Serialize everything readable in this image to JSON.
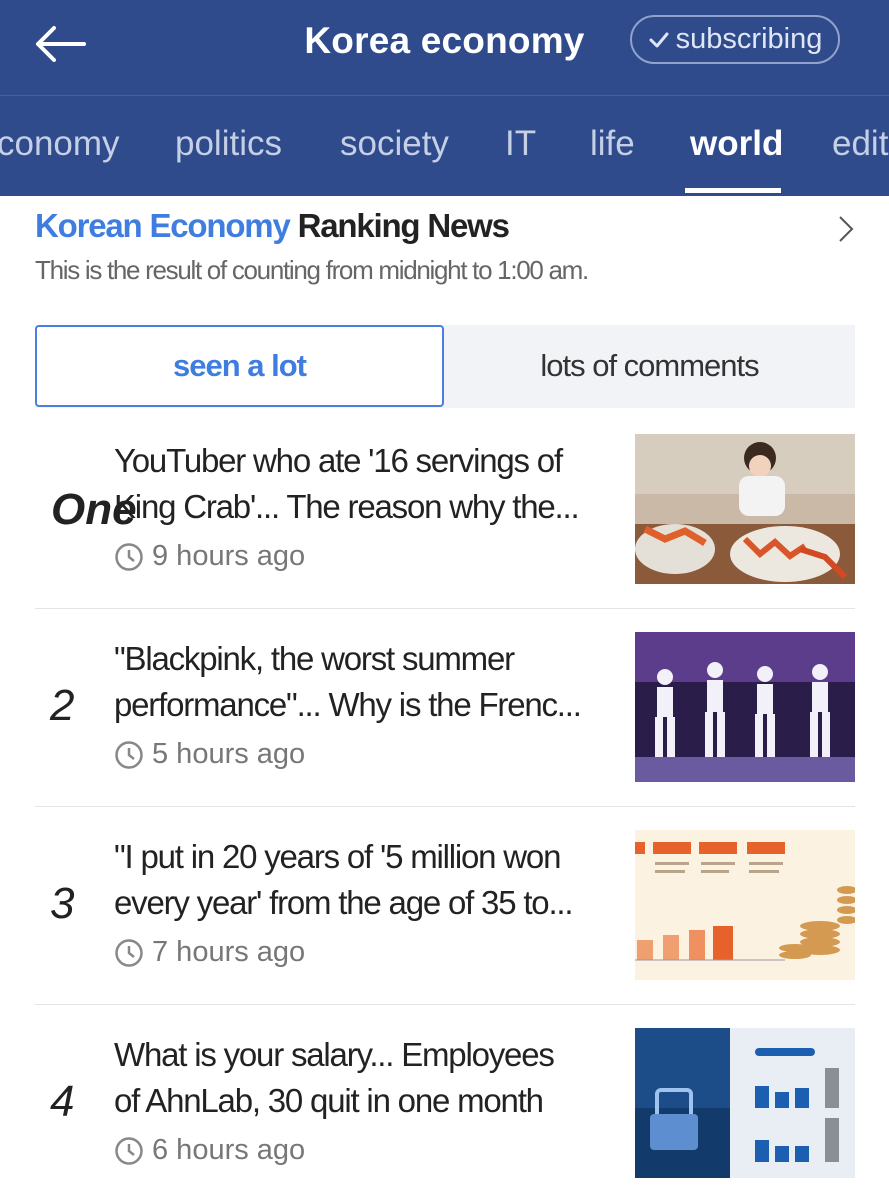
{
  "header": {
    "title": "Korea economy",
    "subscribe_label": "subscribing"
  },
  "tabs": [
    {
      "label": "conomy"
    },
    {
      "label": "politics"
    },
    {
      "label": "society"
    },
    {
      "label": "IT"
    },
    {
      "label": "life"
    },
    {
      "label": "world",
      "active": true
    },
    {
      "label": "edit"
    }
  ],
  "ranking": {
    "brand": "Korean Economy",
    "title": "Ranking News",
    "subtitle": "This is the result of counting from midnight to 1:00 am."
  },
  "segments": {
    "active": "seen a lot",
    "inactive": "lots of comments"
  },
  "articles": [
    {
      "rank": "One",
      "line1": "YouTuber who ate '16 servings of",
      "line2": "King Crab'... The reason why the...",
      "time": "9 hours ago",
      "thumb_icon": "king-crab-photo"
    },
    {
      "rank": "2",
      "line1": "\"Blackpink, the worst summer",
      "line2": "performance\"... Why is the Frenc...",
      "time": "5 hours ago",
      "thumb_icon": "concert-photo"
    },
    {
      "rank": "3",
      "line1": "\"I put in 20 years of '5 million won",
      "line2": "every year' from the age of 35 to...",
      "time": "7 hours ago",
      "thumb_icon": "pension-chart-graphic"
    },
    {
      "rank": "4",
      "line1": "What is your salary... Employees",
      "line2": "of AhnLab, 30 quit in one month",
      "time": "6 hours ago",
      "thumb_icon": "security-salary-graphic"
    }
  ],
  "colors": {
    "header_bg": "#2f4b8c",
    "accent_blue": "#3f7de0"
  }
}
